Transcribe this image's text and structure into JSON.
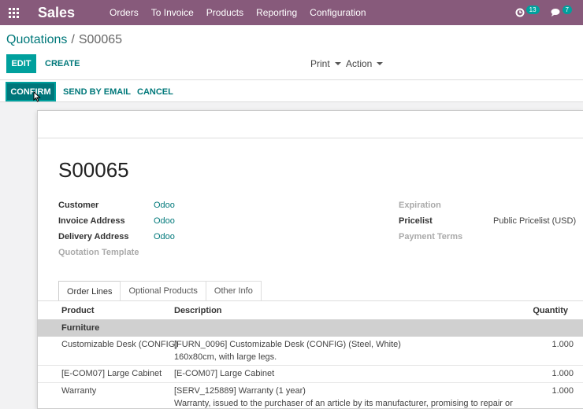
{
  "navbar": {
    "app_name": "Sales",
    "menu": [
      "Orders",
      "To Invoice",
      "Products",
      "Reporting",
      "Configuration"
    ],
    "activity_count": "13",
    "messages_count": "7"
  },
  "breadcrumb": {
    "parent": "Quotations",
    "separator": "/",
    "current": "S00065"
  },
  "actions": {
    "edit": "EDIT",
    "create": "CREATE",
    "print": "Print",
    "action": "Action"
  },
  "statusbar": {
    "confirm": "CONFIRM",
    "send_by_email": "SEND BY EMAIL",
    "cancel": "CANCEL"
  },
  "form": {
    "title": "S00065",
    "left_fields": [
      {
        "label": "Customer",
        "value": "Odoo"
      },
      {
        "label": "Invoice Address",
        "value": "Odoo"
      },
      {
        "label": "Delivery Address",
        "value": "Odoo"
      },
      {
        "label": "Quotation Template",
        "value": ""
      }
    ],
    "right_fields": [
      {
        "label": "Expiration",
        "value": ""
      },
      {
        "label": "Pricelist",
        "value": "Public Pricelist (USD)"
      },
      {
        "label": "Payment Terms",
        "value": ""
      }
    ]
  },
  "tabs": [
    "Order Lines",
    "Optional Products",
    "Other Info"
  ],
  "order_lines": {
    "headers": {
      "product": "Product",
      "description": "Description",
      "quantity": "Quantity"
    },
    "section": "Furniture",
    "rows": [
      {
        "product": "Customizable Desk (CONFIG)",
        "desc1": "[FURN_0096] Customizable Desk (CONFIG) (Steel, White)",
        "desc2": "160x80cm, with large legs.",
        "qty": "1.000"
      },
      {
        "product": "[E-COM07] Large Cabinet",
        "desc1": "[E-COM07] Large Cabinet",
        "desc2": "",
        "qty": "1.000"
      },
      {
        "product": "Warranty",
        "desc1": "[SERV_125889] Warranty (1 year)",
        "desc2": "Warranty, issued to the purchaser of an article by its manufacturer, promising to repair or",
        "qty": "1.000"
      }
    ]
  },
  "colors": {
    "navbar": "#875a7b",
    "primary": "#00a09d",
    "link": "#00787a"
  }
}
